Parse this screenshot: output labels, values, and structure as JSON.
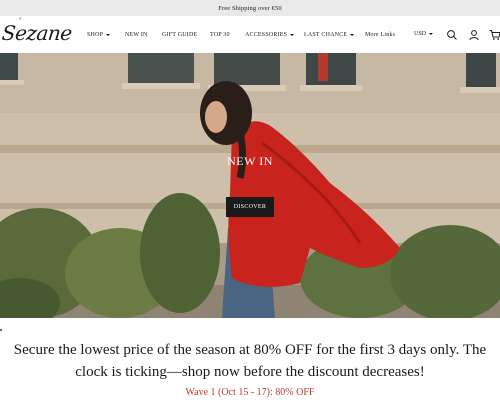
{
  "announcement": "Free Shipping over €50",
  "brand": {
    "logo_text": "Sezane",
    "logo_accent": "´"
  },
  "nav": {
    "items": [
      {
        "label": "SHOP",
        "dropdown": true
      },
      {
        "label": "NEW IN",
        "dropdown": false
      },
      {
        "label": "GIFT GUIDE",
        "dropdown": false
      },
      {
        "label": "TOP 30",
        "dropdown": false
      },
      {
        "label": "ACCESSORIES",
        "dropdown": true
      },
      {
        "label": "LAST CHANCE",
        "dropdown": true
      },
      {
        "label": "More Links",
        "dropdown": false
      }
    ],
    "currency": "USD",
    "icons": [
      "search-icon",
      "account-icon",
      "cart-icon"
    ]
  },
  "hero": {
    "title": "NEW IN",
    "cta_label": "DISCOVER"
  },
  "promo": {
    "text": "Secure the lowest price of the season at 80% OFF for the first 3 days only. The clock is ticking—shop now before the discount decreases!",
    "wave_text": "Wave 1 (Oct 15 - 17): 80% OFF",
    "wave_color": "#c0392b"
  }
}
